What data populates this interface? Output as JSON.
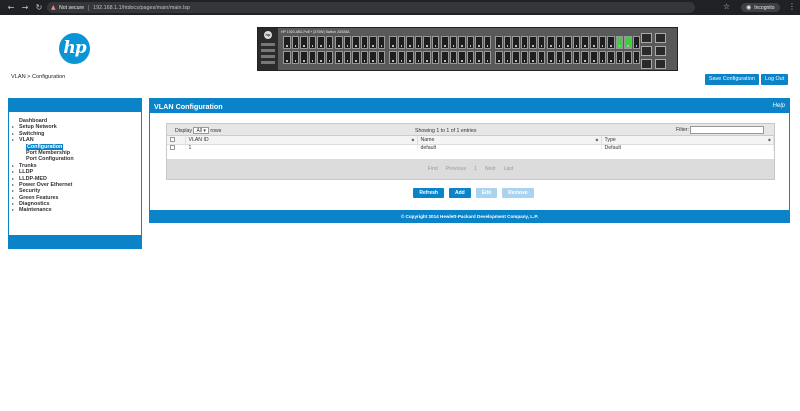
{
  "browser": {
    "not_secure": "Not secure",
    "url": "192.168.1.1/htdocs/pages/main/main.lsp",
    "incognito": "Incognito"
  },
  "header": {
    "logo_text": "hp",
    "breadcrumb": "VLAN > Configuration",
    "save_label": "Save Configuration",
    "logout_label": "Log Out"
  },
  "switch": {
    "model": "HP 1920-48G-PoE+ (370W) Switch JG928A"
  },
  "sidebar": {
    "items": [
      {
        "label": "Dashboard",
        "arrow": false
      },
      {
        "label": "Setup Network",
        "arrow": true
      },
      {
        "label": "Switching",
        "arrow": true
      },
      {
        "label": "VLAN",
        "arrow": true
      },
      {
        "label": "Configuration",
        "sub": true,
        "active": true
      },
      {
        "label": "Port Membership",
        "sub": true
      },
      {
        "label": "Port Configuration",
        "sub": true
      },
      {
        "label": "Trunks",
        "arrow": true
      },
      {
        "label": "LLDP",
        "arrow": true
      },
      {
        "label": "LLDP-MED",
        "arrow": true
      },
      {
        "label": "Power Over Ethernet",
        "arrow": true
      },
      {
        "label": "Security",
        "arrow": true
      },
      {
        "label": "Green Features",
        "arrow": true
      },
      {
        "label": "Diagnostics",
        "arrow": true
      },
      {
        "label": "Maintenance",
        "arrow": true
      }
    ]
  },
  "main": {
    "title": "VLAN Configuration",
    "help": "Help",
    "table": {
      "display_label": "Display",
      "display_value": "All",
      "rows_label": "rows",
      "showing": "Showing 1 to 1 of 1 entries",
      "filter_label": "Filter:",
      "columns": [
        "VLAN ID",
        "Name",
        "Type"
      ],
      "rows": [
        [
          "1",
          "default",
          "Default"
        ]
      ],
      "pager": [
        "First",
        "Previous",
        "1",
        "Next",
        "Last"
      ]
    },
    "actions": {
      "refresh": "Refresh",
      "add": "Add",
      "edit": "Edit",
      "remove": "Remove"
    },
    "copyright": "© Copyright 2014 Hewlett-Packard Development Company, L.P."
  },
  "colors": {
    "accent": "#0a83c8",
    "port_active": "#3ecf3e"
  }
}
